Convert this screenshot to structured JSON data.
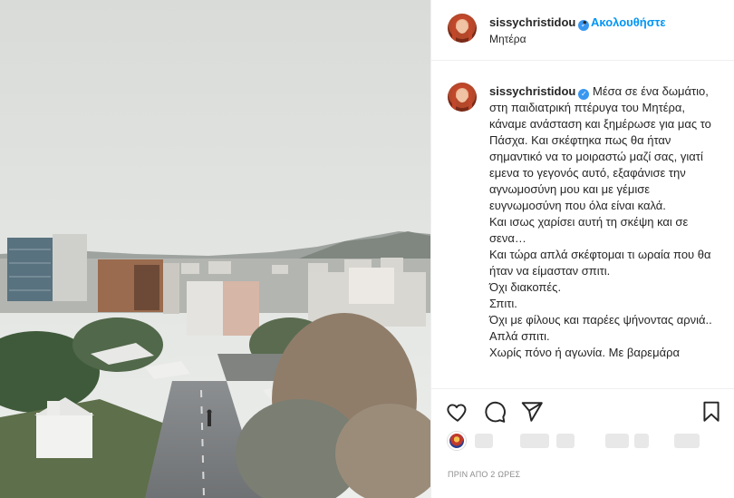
{
  "post": {
    "username": "sissychristidou",
    "verified_mark": "✓",
    "separator": "•",
    "follow_label": "Ακολουθήστε",
    "location": "Μητέρα",
    "caption_lines": [
      "Μέσα σε ένα δωμάτιο, στη παιδιατρική πτέρυγα του Μητέρα, κάναμε ανάσταση και ξημέρωσε για μας το Πάσχα. Και σκέφτηκα πως θα ήταν σημαντικό να το μοιραστώ μαζί σας, γιατί εμενα το γεγονός αυτό, εξαφάνισε την αγνωμοσύνη μου και με γέμισε ευγνωμοσύνη που όλα είναι καλά.",
      "Και ισως χαρίσει αυτή τη σκέψη και σε σενα…",
      "Και τώρα απλά σκέφτομαι τι ωραία που θα ήταν να είμασταν σπιτι.",
      "Όχι διακοπές.",
      "Σπιτι.",
      "Όχι με φίλους και παρέες ψήνοντας αρνιά..",
      "Απλά σπιτι.",
      "Χωρίς πόνο ή αγωνία. Με βαρεμάρα"
    ],
    "timestamp": "ΠΡΙΝ ΑΠΟ 2 ΩΡΕΣ"
  },
  "icons": {
    "like": "heart-icon",
    "comment": "comment-icon",
    "share": "paper-plane-icon",
    "save": "bookmark-icon"
  },
  "colors": {
    "accent": "#0095f6",
    "verified": "#3897f0",
    "text": "#262626",
    "muted": "#8e8e8e",
    "border": "#efefef"
  }
}
